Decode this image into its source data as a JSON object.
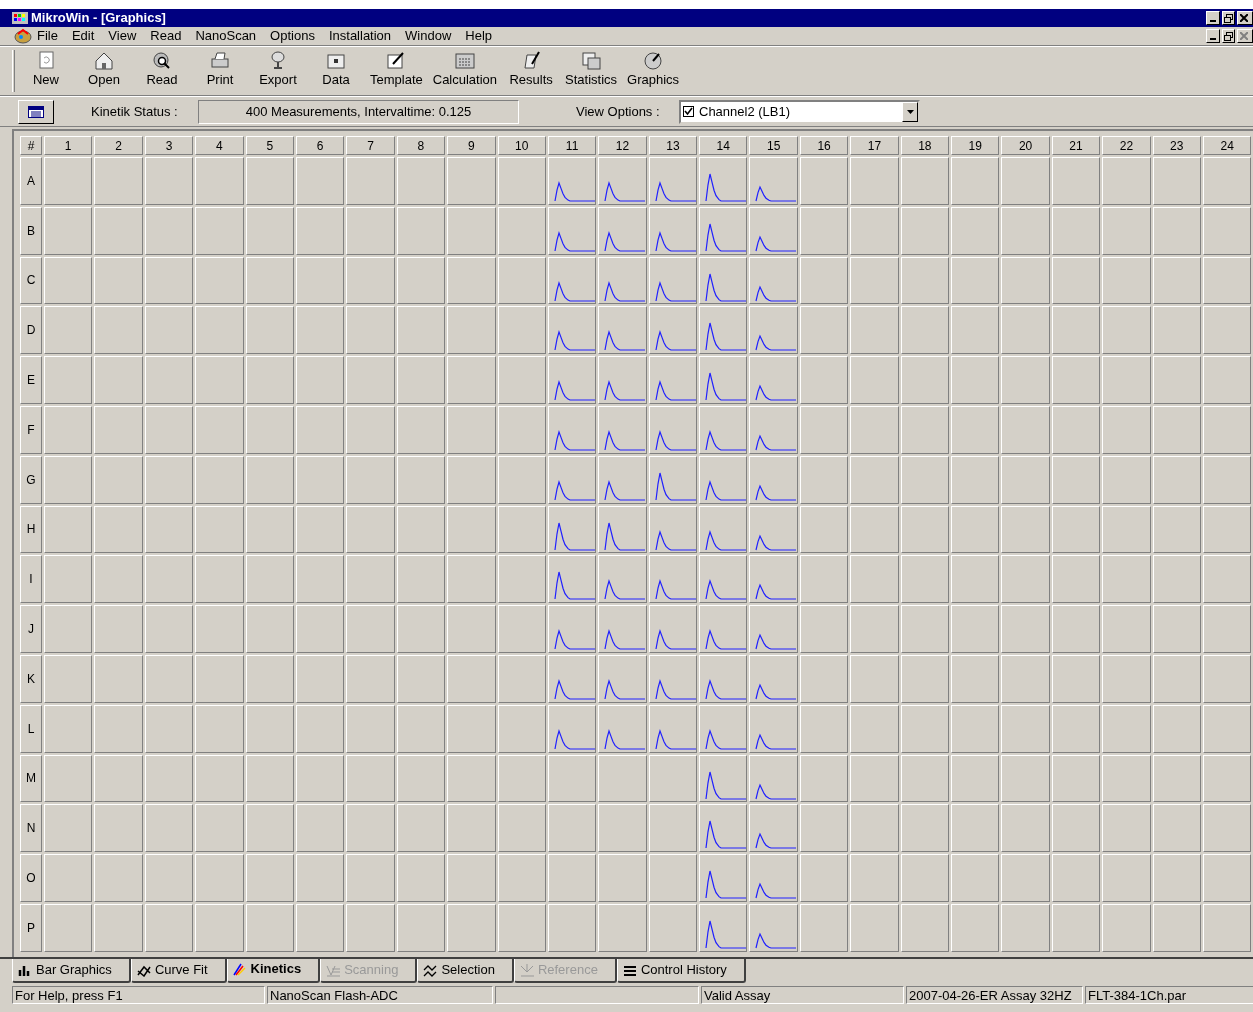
{
  "window": {
    "title": "MikroWin - [Graphics]"
  },
  "menu": [
    "File",
    "Edit",
    "View",
    "Read",
    "NanoScan",
    "Options",
    "Installation",
    "Window",
    "Help"
  ],
  "toolbar": [
    {
      "label": "New",
      "kind": "new"
    },
    {
      "label": "Open",
      "kind": "open"
    },
    {
      "label": "Read",
      "kind": "read"
    },
    {
      "label": "Print",
      "kind": "print"
    },
    {
      "label": "Export",
      "kind": "export"
    },
    {
      "label": "Data",
      "kind": "data"
    },
    {
      "label": "Template",
      "kind": "template"
    },
    {
      "label": "Calculation",
      "kind": "calculation"
    },
    {
      "label": "Results",
      "kind": "results"
    },
    {
      "label": "Statistics",
      "kind": "statistics"
    },
    {
      "label": "Graphics",
      "kind": "graphics"
    }
  ],
  "status_row": {
    "kinetik_label": "Kinetik Status :",
    "kinetik_value": "400 Measurements, Intervaltime: 0.125",
    "view_label": "View Options :",
    "view_option": {
      "label": "Channel2 (LB1)",
      "checked": true
    }
  },
  "plate": {
    "corner": "#",
    "columns": [
      "1",
      "2",
      "3",
      "4",
      "5",
      "6",
      "7",
      "8",
      "9",
      "10",
      "11",
      "12",
      "13",
      "14",
      "15",
      "16",
      "17",
      "18",
      "19",
      "20",
      "21",
      "22",
      "23",
      "24"
    ],
    "rows": [
      {
        "label": "A",
        "wells": [
          {
            "curve": false
          },
          {
            "curve": false
          },
          {
            "curve": false
          },
          {
            "curve": false
          },
          {
            "curve": false
          },
          {
            "curve": false
          },
          {
            "curve": false
          },
          {
            "curve": false
          },
          {
            "curve": false
          },
          {
            "curve": false
          },
          {
            "curve": true,
            "kind": "peak"
          },
          {
            "curve": true,
            "kind": "peak"
          },
          {
            "curve": true,
            "kind": "peak"
          },
          {
            "curve": true,
            "kind": "tall"
          },
          {
            "curve": true,
            "kind": "low"
          },
          {
            "curve": false
          },
          {
            "curve": false
          },
          {
            "curve": false
          },
          {
            "curve": false
          },
          {
            "curve": false
          },
          {
            "curve": false
          },
          {
            "curve": false
          },
          {
            "curve": false
          },
          {
            "curve": false
          }
        ]
      },
      {
        "label": "B",
        "wells": [
          {
            "curve": false
          },
          {
            "curve": false
          },
          {
            "curve": false
          },
          {
            "curve": false
          },
          {
            "curve": false
          },
          {
            "curve": false
          },
          {
            "curve": false
          },
          {
            "curve": false
          },
          {
            "curve": false
          },
          {
            "curve": false
          },
          {
            "curve": true,
            "kind": "peak"
          },
          {
            "curve": true,
            "kind": "peak"
          },
          {
            "curve": true,
            "kind": "peak"
          },
          {
            "curve": true,
            "kind": "tall"
          },
          {
            "curve": true,
            "kind": "low"
          },
          {
            "curve": false
          },
          {
            "curve": false
          },
          {
            "curve": false
          },
          {
            "curve": false
          },
          {
            "curve": false
          },
          {
            "curve": false
          },
          {
            "curve": false
          },
          {
            "curve": false
          },
          {
            "curve": false
          }
        ]
      },
      {
        "label": "C",
        "wells": [
          {
            "curve": false
          },
          {
            "curve": false
          },
          {
            "curve": false
          },
          {
            "curve": false
          },
          {
            "curve": false
          },
          {
            "curve": false
          },
          {
            "curve": false
          },
          {
            "curve": false
          },
          {
            "curve": false
          },
          {
            "curve": false
          },
          {
            "curve": true,
            "kind": "peak"
          },
          {
            "curve": true,
            "kind": "peak"
          },
          {
            "curve": true,
            "kind": "peak"
          },
          {
            "curve": true,
            "kind": "tall"
          },
          {
            "curve": true,
            "kind": "low"
          },
          {
            "curve": false
          },
          {
            "curve": false
          },
          {
            "curve": false
          },
          {
            "curve": false
          },
          {
            "curve": false
          },
          {
            "curve": false
          },
          {
            "curve": false
          },
          {
            "curve": false
          },
          {
            "curve": false
          }
        ]
      },
      {
        "label": "D",
        "wells": [
          {
            "curve": false
          },
          {
            "curve": false
          },
          {
            "curve": false
          },
          {
            "curve": false
          },
          {
            "curve": false
          },
          {
            "curve": false
          },
          {
            "curve": false
          },
          {
            "curve": false
          },
          {
            "curve": false
          },
          {
            "curve": false
          },
          {
            "curve": true,
            "kind": "peak"
          },
          {
            "curve": true,
            "kind": "peak"
          },
          {
            "curve": true,
            "kind": "peak"
          },
          {
            "curve": true,
            "kind": "tall"
          },
          {
            "curve": true,
            "kind": "low"
          },
          {
            "curve": false
          },
          {
            "curve": false
          },
          {
            "curve": false
          },
          {
            "curve": false
          },
          {
            "curve": false
          },
          {
            "curve": false
          },
          {
            "curve": false
          },
          {
            "curve": false
          },
          {
            "curve": false
          }
        ]
      },
      {
        "label": "E",
        "wells": [
          {
            "curve": false
          },
          {
            "curve": false
          },
          {
            "curve": false
          },
          {
            "curve": false
          },
          {
            "curve": false
          },
          {
            "curve": false
          },
          {
            "curve": false
          },
          {
            "curve": false
          },
          {
            "curve": false
          },
          {
            "curve": false
          },
          {
            "curve": true,
            "kind": "peak"
          },
          {
            "curve": true,
            "kind": "peak"
          },
          {
            "curve": true,
            "kind": "peak"
          },
          {
            "curve": true,
            "kind": "tall"
          },
          {
            "curve": true,
            "kind": "low"
          },
          {
            "curve": false
          },
          {
            "curve": false
          },
          {
            "curve": false
          },
          {
            "curve": false
          },
          {
            "curve": false
          },
          {
            "curve": false
          },
          {
            "curve": false
          },
          {
            "curve": false
          },
          {
            "curve": false
          }
        ]
      },
      {
        "label": "F",
        "wells": [
          {
            "curve": false
          },
          {
            "curve": false
          },
          {
            "curve": false
          },
          {
            "curve": false
          },
          {
            "curve": false
          },
          {
            "curve": false
          },
          {
            "curve": false
          },
          {
            "curve": false
          },
          {
            "curve": false
          },
          {
            "curve": false
          },
          {
            "curve": true,
            "kind": "peak"
          },
          {
            "curve": true,
            "kind": "peak"
          },
          {
            "curve": true,
            "kind": "peak"
          },
          {
            "curve": true,
            "kind": "peak"
          },
          {
            "curve": true,
            "kind": "low"
          },
          {
            "curve": false
          },
          {
            "curve": false
          },
          {
            "curve": false
          },
          {
            "curve": false
          },
          {
            "curve": false
          },
          {
            "curve": false
          },
          {
            "curve": false
          },
          {
            "curve": false
          },
          {
            "curve": false
          }
        ]
      },
      {
        "label": "G",
        "wells": [
          {
            "curve": false
          },
          {
            "curve": false
          },
          {
            "curve": false
          },
          {
            "curve": false
          },
          {
            "curve": false
          },
          {
            "curve": false
          },
          {
            "curve": false
          },
          {
            "curve": false
          },
          {
            "curve": false
          },
          {
            "curve": false
          },
          {
            "curve": true,
            "kind": "peak"
          },
          {
            "curve": true,
            "kind": "peak"
          },
          {
            "curve": true,
            "kind": "tall"
          },
          {
            "curve": true,
            "kind": "peak"
          },
          {
            "curve": true,
            "kind": "low"
          },
          {
            "curve": false
          },
          {
            "curve": false
          },
          {
            "curve": false
          },
          {
            "curve": false
          },
          {
            "curve": false
          },
          {
            "curve": false
          },
          {
            "curve": false
          },
          {
            "curve": false
          },
          {
            "curve": false
          }
        ]
      },
      {
        "label": "H",
        "wells": [
          {
            "curve": false
          },
          {
            "curve": false
          },
          {
            "curve": false
          },
          {
            "curve": false
          },
          {
            "curve": false
          },
          {
            "curve": false
          },
          {
            "curve": false
          },
          {
            "curve": false
          },
          {
            "curve": false
          },
          {
            "curve": false
          },
          {
            "curve": true,
            "kind": "tall"
          },
          {
            "curve": true,
            "kind": "tall"
          },
          {
            "curve": true,
            "kind": "peak"
          },
          {
            "curve": true,
            "kind": "peak"
          },
          {
            "curve": true,
            "kind": "low"
          },
          {
            "curve": false
          },
          {
            "curve": false
          },
          {
            "curve": false
          },
          {
            "curve": false
          },
          {
            "curve": false
          },
          {
            "curve": false
          },
          {
            "curve": false
          },
          {
            "curve": false
          },
          {
            "curve": false
          }
        ]
      },
      {
        "label": "I",
        "wells": [
          {
            "curve": false
          },
          {
            "curve": false
          },
          {
            "curve": false
          },
          {
            "curve": false
          },
          {
            "curve": false
          },
          {
            "curve": false
          },
          {
            "curve": false
          },
          {
            "curve": false
          },
          {
            "curve": false
          },
          {
            "curve": false
          },
          {
            "curve": true,
            "kind": "tall"
          },
          {
            "curve": true,
            "kind": "peak"
          },
          {
            "curve": true,
            "kind": "peak"
          },
          {
            "curve": true,
            "kind": "peak"
          },
          {
            "curve": true,
            "kind": "low"
          },
          {
            "curve": false
          },
          {
            "curve": false
          },
          {
            "curve": false
          },
          {
            "curve": false
          },
          {
            "curve": false
          },
          {
            "curve": false
          },
          {
            "curve": false
          },
          {
            "curve": false
          },
          {
            "curve": false
          }
        ]
      },
      {
        "label": "J",
        "wells": [
          {
            "curve": false
          },
          {
            "curve": false
          },
          {
            "curve": false
          },
          {
            "curve": false
          },
          {
            "curve": false
          },
          {
            "curve": false
          },
          {
            "curve": false
          },
          {
            "curve": false
          },
          {
            "curve": false
          },
          {
            "curve": false
          },
          {
            "curve": true,
            "kind": "peak"
          },
          {
            "curve": true,
            "kind": "peak"
          },
          {
            "curve": true,
            "kind": "peak"
          },
          {
            "curve": true,
            "kind": "peak"
          },
          {
            "curve": true,
            "kind": "low"
          },
          {
            "curve": false
          },
          {
            "curve": false
          },
          {
            "curve": false
          },
          {
            "curve": false
          },
          {
            "curve": false
          },
          {
            "curve": false
          },
          {
            "curve": false
          },
          {
            "curve": false
          },
          {
            "curve": false
          }
        ]
      },
      {
        "label": "K",
        "wells": [
          {
            "curve": false
          },
          {
            "curve": false
          },
          {
            "curve": false
          },
          {
            "curve": false
          },
          {
            "curve": false
          },
          {
            "curve": false
          },
          {
            "curve": false
          },
          {
            "curve": false
          },
          {
            "curve": false
          },
          {
            "curve": false
          },
          {
            "curve": true,
            "kind": "peak"
          },
          {
            "curve": true,
            "kind": "peak"
          },
          {
            "curve": true,
            "kind": "peak"
          },
          {
            "curve": true,
            "kind": "peak"
          },
          {
            "curve": true,
            "kind": "low"
          },
          {
            "curve": false
          },
          {
            "curve": false
          },
          {
            "curve": false
          },
          {
            "curve": false
          },
          {
            "curve": false
          },
          {
            "curve": false
          },
          {
            "curve": false
          },
          {
            "curve": false
          },
          {
            "curve": false
          }
        ]
      },
      {
        "label": "L",
        "wells": [
          {
            "curve": false
          },
          {
            "curve": false
          },
          {
            "curve": false
          },
          {
            "curve": false
          },
          {
            "curve": false
          },
          {
            "curve": false
          },
          {
            "curve": false
          },
          {
            "curve": false
          },
          {
            "curve": false
          },
          {
            "curve": false
          },
          {
            "curve": true,
            "kind": "peak"
          },
          {
            "curve": true,
            "kind": "peak"
          },
          {
            "curve": true,
            "kind": "peak"
          },
          {
            "curve": true,
            "kind": "peak"
          },
          {
            "curve": true,
            "kind": "low"
          },
          {
            "curve": false
          },
          {
            "curve": false
          },
          {
            "curve": false
          },
          {
            "curve": false
          },
          {
            "curve": false
          },
          {
            "curve": false
          },
          {
            "curve": false
          },
          {
            "curve": false
          },
          {
            "curve": false
          }
        ]
      },
      {
        "label": "M",
        "wells": [
          {
            "curve": false
          },
          {
            "curve": false
          },
          {
            "curve": false
          },
          {
            "curve": false
          },
          {
            "curve": false
          },
          {
            "curve": false
          },
          {
            "curve": false
          },
          {
            "curve": false
          },
          {
            "curve": false
          },
          {
            "curve": false
          },
          {
            "curve": false
          },
          {
            "curve": false
          },
          {
            "curve": false
          },
          {
            "curve": true,
            "kind": "tall"
          },
          {
            "curve": true,
            "kind": "low"
          },
          {
            "curve": false
          },
          {
            "curve": false
          },
          {
            "curve": false
          },
          {
            "curve": false
          },
          {
            "curve": false
          },
          {
            "curve": false
          },
          {
            "curve": false
          },
          {
            "curve": false
          },
          {
            "curve": false
          }
        ]
      },
      {
        "label": "N",
        "wells": [
          {
            "curve": false
          },
          {
            "curve": false
          },
          {
            "curve": false
          },
          {
            "curve": false
          },
          {
            "curve": false
          },
          {
            "curve": false
          },
          {
            "curve": false
          },
          {
            "curve": false
          },
          {
            "curve": false
          },
          {
            "curve": false
          },
          {
            "curve": false
          },
          {
            "curve": false
          },
          {
            "curve": false
          },
          {
            "curve": true,
            "kind": "tall"
          },
          {
            "curve": true,
            "kind": "low"
          },
          {
            "curve": false
          },
          {
            "curve": false
          },
          {
            "curve": false
          },
          {
            "curve": false
          },
          {
            "curve": false
          },
          {
            "curve": false
          },
          {
            "curve": false
          },
          {
            "curve": false
          },
          {
            "curve": false
          }
        ]
      },
      {
        "label": "O",
        "wells": [
          {
            "curve": false
          },
          {
            "curve": false
          },
          {
            "curve": false
          },
          {
            "curve": false
          },
          {
            "curve": false
          },
          {
            "curve": false
          },
          {
            "curve": false
          },
          {
            "curve": false
          },
          {
            "curve": false
          },
          {
            "curve": false
          },
          {
            "curve": false
          },
          {
            "curve": false
          },
          {
            "curve": false
          },
          {
            "curve": true,
            "kind": "tall"
          },
          {
            "curve": true,
            "kind": "low"
          },
          {
            "curve": false
          },
          {
            "curve": false
          },
          {
            "curve": false
          },
          {
            "curve": false
          },
          {
            "curve": false
          },
          {
            "curve": false
          },
          {
            "curve": false
          },
          {
            "curve": false
          },
          {
            "curve": false
          }
        ]
      },
      {
        "label": "P",
        "wells": [
          {
            "curve": false
          },
          {
            "curve": false
          },
          {
            "curve": false
          },
          {
            "curve": false
          },
          {
            "curve": false
          },
          {
            "curve": false
          },
          {
            "curve": false
          },
          {
            "curve": false
          },
          {
            "curve": false
          },
          {
            "curve": false
          },
          {
            "curve": false
          },
          {
            "curve": false
          },
          {
            "curve": false
          },
          {
            "curve": true,
            "kind": "tall"
          },
          {
            "curve": true,
            "kind": "low"
          },
          {
            "curve": false
          },
          {
            "curve": false
          },
          {
            "curve": false
          },
          {
            "curve": false
          },
          {
            "curve": false
          },
          {
            "curve": false
          },
          {
            "curve": false
          },
          {
            "curve": false
          },
          {
            "curve": false
          }
        ]
      }
    ]
  },
  "tabs": [
    {
      "label": "Bar Graphics",
      "kind": "bars",
      "selected": false,
      "disabled": false
    },
    {
      "label": "Curve Fit",
      "kind": "fit",
      "selected": false,
      "disabled": false
    },
    {
      "label": "Kinetics",
      "kind": "kinetics",
      "selected": true,
      "disabled": false
    },
    {
      "label": "Scanning",
      "kind": "scanning",
      "selected": false,
      "disabled": true
    },
    {
      "label": "Selection",
      "kind": "selection",
      "selected": false,
      "disabled": false
    },
    {
      "label": "Reference",
      "kind": "reference",
      "selected": false,
      "disabled": true
    },
    {
      "label": "Control History",
      "kind": "history",
      "selected": false,
      "disabled": false
    }
  ],
  "status_bar": [
    "For Help, press F1",
    "NanoScan Flash-ADC",
    "Valid Assay",
    "2007-04-26-ER  Assay  32HZ",
    "FLT-384-1Ch.par"
  ]
}
